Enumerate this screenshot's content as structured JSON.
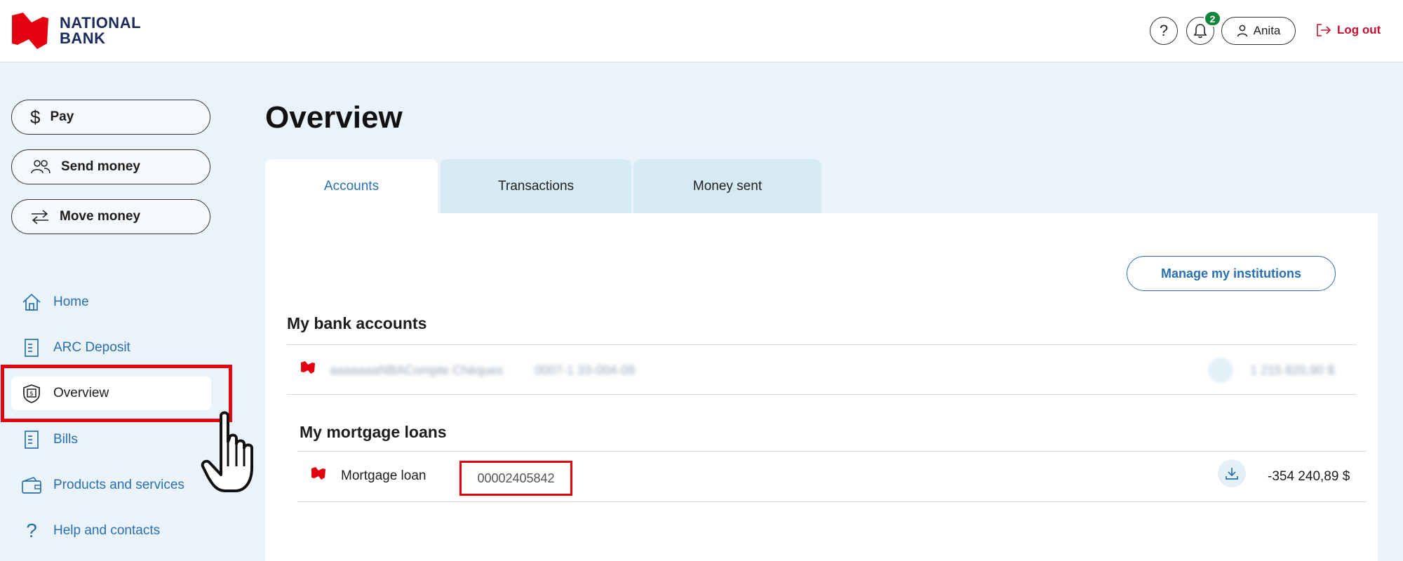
{
  "header": {
    "logo_line1": "NATIONAL",
    "logo_line2": "BANK",
    "help_icon": "question-mark-icon",
    "notifications_count": "2",
    "user_name": "Anita",
    "logout_label": "Log out"
  },
  "sidebar": {
    "actions": [
      {
        "label": "Pay",
        "icon": "dollar-icon"
      },
      {
        "label": "Send money",
        "icon": "people-icon"
      },
      {
        "label": "Move money",
        "icon": "arrows-icon"
      }
    ],
    "nav": [
      {
        "label": "Home",
        "icon": "home-icon"
      },
      {
        "label": "ARC Deposit",
        "icon": "document-icon"
      },
      {
        "label": "Overview",
        "icon": "money-shield-icon",
        "active": true
      },
      {
        "label": "Bills",
        "icon": "document-icon"
      },
      {
        "label": "Products and services",
        "icon": "wallet-icon"
      },
      {
        "label": "Help and contacts",
        "icon": "question-icon"
      }
    ]
  },
  "main": {
    "title": "Overview",
    "tabs": [
      {
        "label": "Accounts",
        "active": true
      },
      {
        "label": "Transactions"
      },
      {
        "label": "Money sent"
      }
    ],
    "manage_button": "Manage my institutions",
    "bank_accounts": {
      "title": "My bank accounts",
      "row": {
        "name": "aaaaaaaNBACompte Chèques",
        "number": "0007-1 33-004-09",
        "amount": "1 215 820,90 $"
      }
    },
    "mortgage_loans": {
      "title": "My mortgage loans",
      "row": {
        "name": "Mortgage loan",
        "number": "00002405842",
        "amount": "-354 240,89 $"
      }
    }
  },
  "colors": {
    "brand_red": "#e3000f",
    "link_blue": "#2a6fb0",
    "page_bg": "#eaf3fa",
    "tab_bg": "#d5eaf3",
    "badge_green": "#13853b"
  }
}
